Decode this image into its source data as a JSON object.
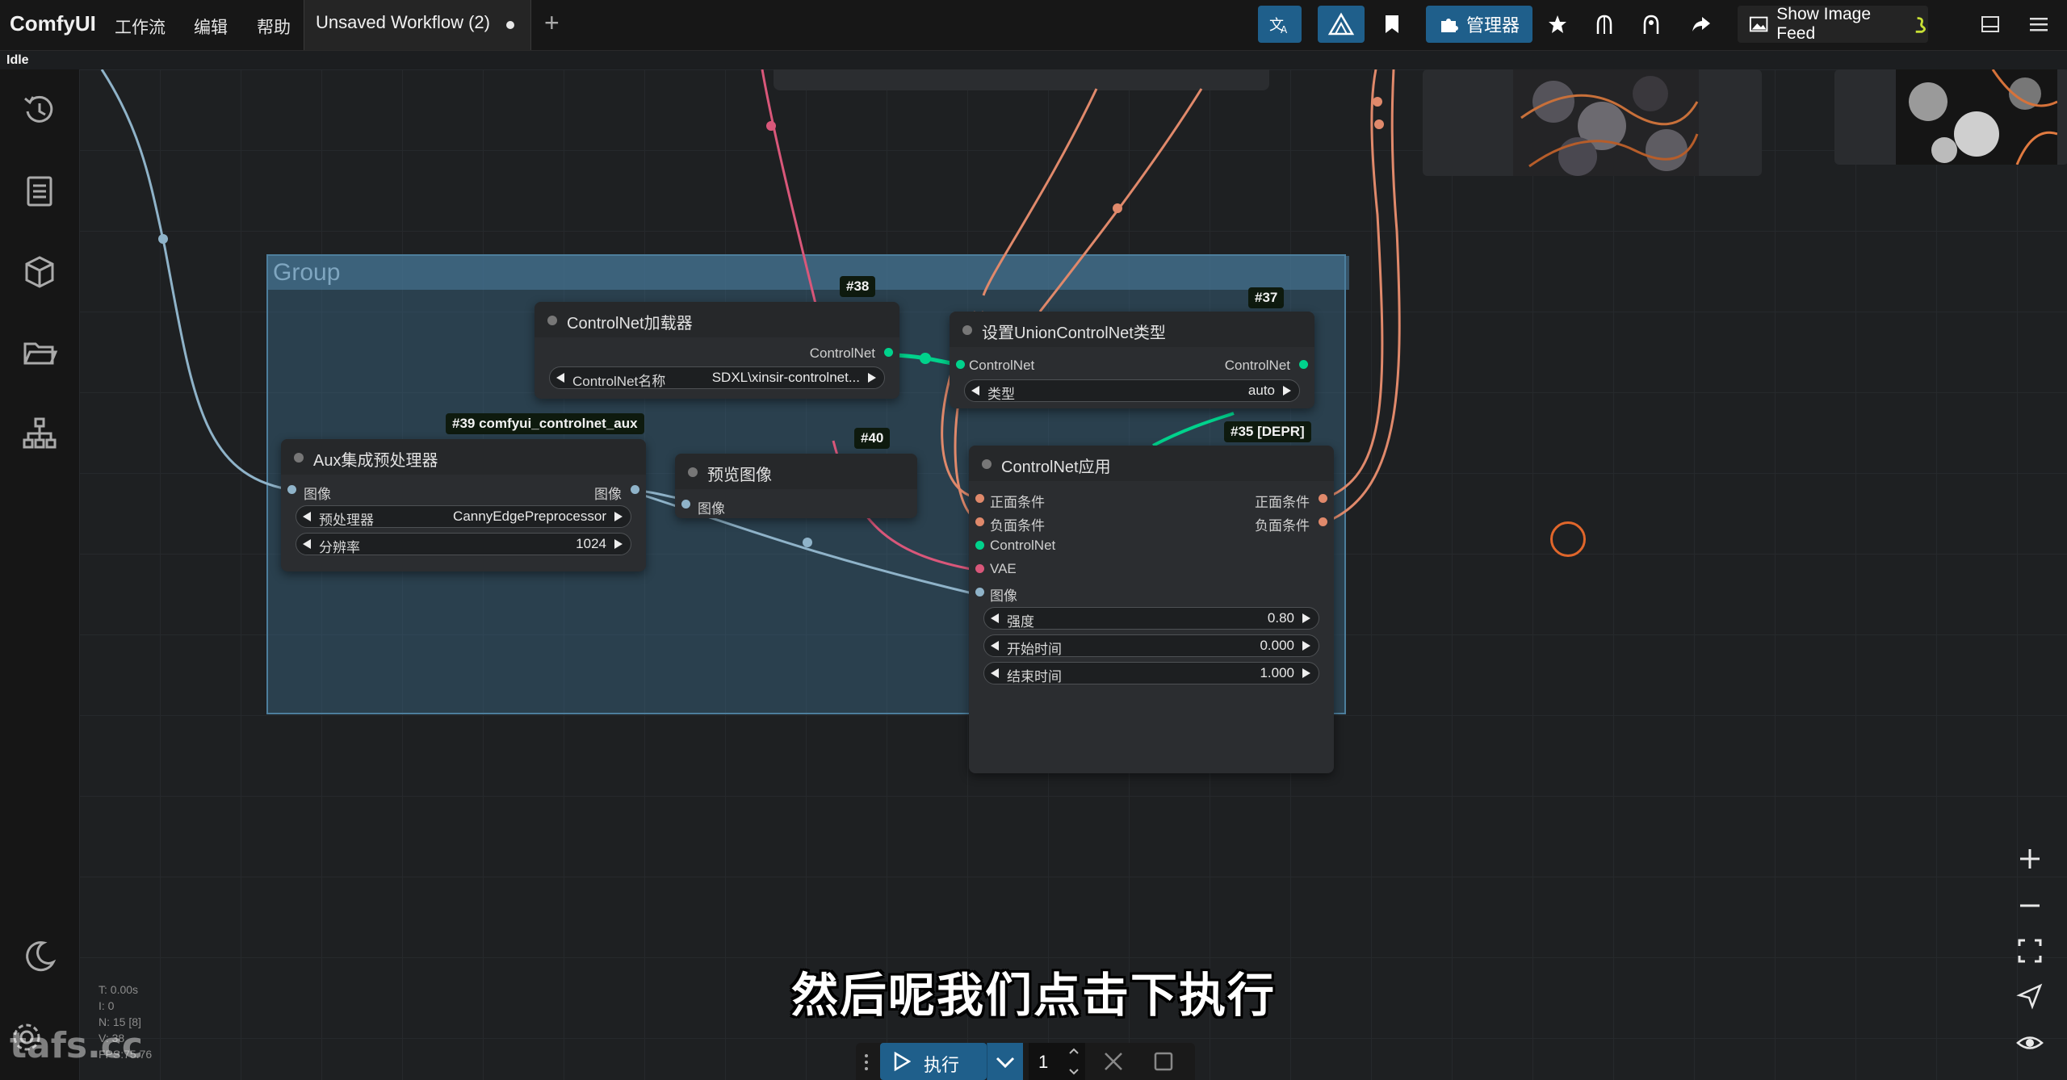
{
  "app": {
    "brand": "ComfyUI",
    "menu": [
      "工作流",
      "编辑",
      "帮助"
    ],
    "tab_title": "Unsaved Workflow (2)",
    "status": "Idle"
  },
  "toolbar": {
    "manager_label": "管理器",
    "image_feed_label": "Show Image Feed"
  },
  "group": {
    "title": "Group"
  },
  "nodes": {
    "controlnet_loader": {
      "badge": "#38",
      "title": "ControlNet加载器",
      "output": "ControlNet",
      "widget_name": "ControlNet名称",
      "widget_value": "SDXL\\xinsir-controlnet..."
    },
    "aux_preprocessor": {
      "badge": "#39 comfyui_controlnet_aux",
      "title": "Aux集成预处理器",
      "input": "图像",
      "output": "图像",
      "w1_name": "预处理器",
      "w1_value": "CannyEdgePreprocessor",
      "w2_name": "分辨率",
      "w2_value": "1024"
    },
    "preview_image": {
      "badge": "#40",
      "title": "预览图像",
      "input": "图像"
    },
    "union_type": {
      "badge": "#37",
      "title": "设置UnionControlNet类型",
      "input": "ControlNet",
      "output": "ControlNet",
      "w_name": "类型",
      "w_value": "auto"
    },
    "controlnet_apply": {
      "badge": "#35 [DEPR]",
      "title": "ControlNet应用",
      "in_positive": "正面条件",
      "in_negative": "负面条件",
      "in_controlnet": "ControlNet",
      "in_vae": "VAE",
      "in_image": "图像",
      "out_positive": "正面条件",
      "out_negative": "负面条件",
      "strength_name": "强度",
      "strength_value": "0.80",
      "start_name": "开始时间",
      "start_value": "0.000",
      "end_name": "结束时间",
      "end_value": "1.000"
    }
  },
  "run": {
    "label": "执行",
    "count": "1"
  },
  "stats": {
    "t": "T: 0.00s",
    "i": "I: 0",
    "n": "N: 15 [8]",
    "v": "V: 38",
    "fps": "FPS:75.76"
  },
  "subtitle": "然后呢我们点击下执行",
  "watermark": "tafs.cc",
  "colors": {
    "accent": "#1f5f8b",
    "link_controlnet": "#00d28c",
    "link_image": "#8fb3c9",
    "link_conditioning": "#e0896b",
    "link_vae": "#d9577a"
  }
}
